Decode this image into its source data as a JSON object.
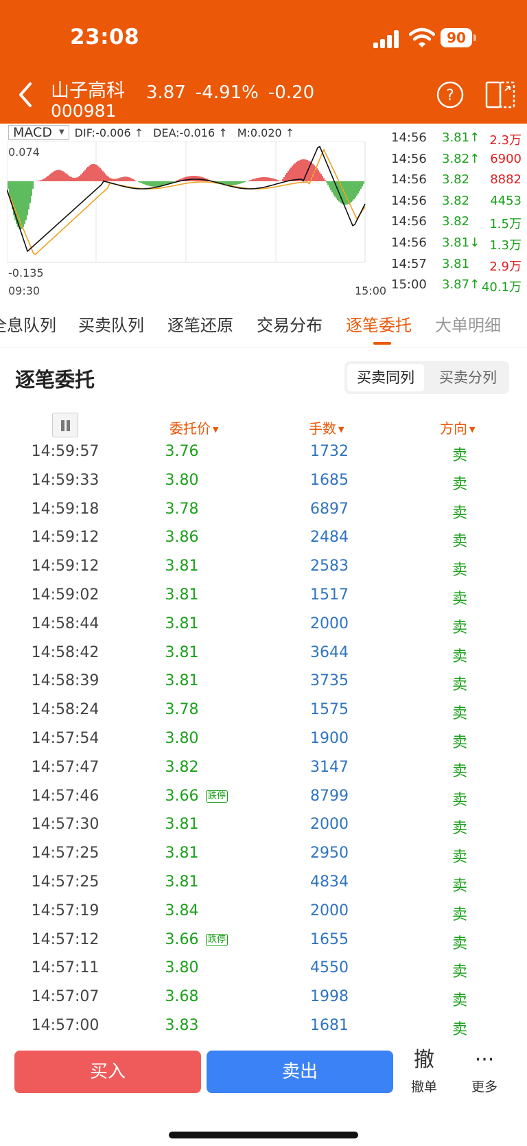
{
  "status": {
    "time": "23:08",
    "battery": "90"
  },
  "header": {
    "name": "山子高科",
    "code": "000981",
    "price": "3.87",
    "change_pct": "-4.91%",
    "change": "-0.20"
  },
  "chart": {
    "indicator": "MACD",
    "dif": "DIF:-0.006 ↑",
    "dea": "DEA:-0.016 ↑",
    "m": "M:0.020 ↑",
    "y_top": "0.074",
    "y_bottom": "-0.135",
    "x_start": "09:30",
    "x_end": "15:00"
  },
  "ticks": [
    {
      "time": "14:56",
      "price": "3.81↑",
      "vol": "2.3万",
      "pcolor": "#1aa01a",
      "vcolor": "#e02020"
    },
    {
      "time": "14:56",
      "price": "3.82↑",
      "vol": "6900",
      "pcolor": "#1aa01a",
      "vcolor": "#e02020"
    },
    {
      "time": "14:56",
      "price": "3.82",
      "vol": "8882",
      "pcolor": "#1aa01a",
      "vcolor": "#e02020"
    },
    {
      "time": "14:56",
      "price": "3.82",
      "vol": "4453",
      "pcolor": "#1aa01a",
      "vcolor": "#1aa01a"
    },
    {
      "time": "14:56",
      "price": "3.82",
      "vol": "1.5万",
      "pcolor": "#1aa01a",
      "vcolor": "#1aa01a"
    },
    {
      "time": "14:56",
      "price": "3.81↓",
      "vol": "1.3万",
      "pcolor": "#1aa01a",
      "vcolor": "#1aa01a"
    },
    {
      "time": "14:57",
      "price": "3.81",
      "vol": "2.9万",
      "pcolor": "#1aa01a",
      "vcolor": "#e02020"
    },
    {
      "time": "15:00",
      "price": "3.87↑",
      "vol": "40.1万",
      "pcolor": "#1aa01a",
      "vcolor": "#1aa01a"
    }
  ],
  "tabs": [
    {
      "label": "全息队列"
    },
    {
      "label": "买卖队列"
    },
    {
      "label": "逐笔还原"
    },
    {
      "label": "交易分布"
    },
    {
      "label": "逐笔委托"
    },
    {
      "label": "大单明细"
    }
  ],
  "section": {
    "title": "逐笔委托",
    "seg_on": "买卖同列",
    "seg_off": "买卖分列"
  },
  "columns": {
    "price": "委托价",
    "volume": "手数",
    "direction": "方向"
  },
  "rows": [
    {
      "time": "14:59:57",
      "price": "3.76",
      "vol": "1732",
      "dir": "卖",
      "tag": ""
    },
    {
      "time": "14:59:33",
      "price": "3.80",
      "vol": "1685",
      "dir": "卖",
      "tag": ""
    },
    {
      "time": "14:59:18",
      "price": "3.78",
      "vol": "6897",
      "dir": "卖",
      "tag": ""
    },
    {
      "time": "14:59:12",
      "price": "3.86",
      "vol": "2484",
      "dir": "卖",
      "tag": ""
    },
    {
      "time": "14:59:12",
      "price": "3.81",
      "vol": "2583",
      "dir": "卖",
      "tag": ""
    },
    {
      "time": "14:59:02",
      "price": "3.81",
      "vol": "1517",
      "dir": "卖",
      "tag": ""
    },
    {
      "time": "14:58:44",
      "price": "3.81",
      "vol": "2000",
      "dir": "卖",
      "tag": ""
    },
    {
      "time": "14:58:42",
      "price": "3.81",
      "vol": "3644",
      "dir": "卖",
      "tag": ""
    },
    {
      "time": "14:58:39",
      "price": "3.81",
      "vol": "3735",
      "dir": "卖",
      "tag": ""
    },
    {
      "time": "14:58:24",
      "price": "3.78",
      "vol": "1575",
      "dir": "卖",
      "tag": ""
    },
    {
      "time": "14:57:54",
      "price": "3.80",
      "vol": "1900",
      "dir": "卖",
      "tag": ""
    },
    {
      "time": "14:57:47",
      "price": "3.82",
      "vol": "3147",
      "dir": "卖",
      "tag": ""
    },
    {
      "time": "14:57:46",
      "price": "3.66",
      "vol": "8799",
      "dir": "卖",
      "tag": "跌停"
    },
    {
      "time": "14:57:30",
      "price": "3.81",
      "vol": "2000",
      "dir": "卖",
      "tag": ""
    },
    {
      "time": "14:57:25",
      "price": "3.81",
      "vol": "2950",
      "dir": "卖",
      "tag": ""
    },
    {
      "time": "14:57:25",
      "price": "3.81",
      "vol": "4834",
      "dir": "卖",
      "tag": ""
    },
    {
      "time": "14:57:19",
      "price": "3.84",
      "vol": "2000",
      "dir": "卖",
      "tag": ""
    },
    {
      "time": "14:57:12",
      "price": "3.66",
      "vol": "1655",
      "dir": "卖",
      "tag": "跌停"
    },
    {
      "time": "14:57:11",
      "price": "3.80",
      "vol": "4550",
      "dir": "卖",
      "tag": ""
    },
    {
      "time": "14:57:07",
      "price": "3.68",
      "vol": "1998",
      "dir": "卖",
      "tag": ""
    },
    {
      "time": "14:57:00",
      "price": "3.83",
      "vol": "1681",
      "dir": "卖",
      "tag": ""
    }
  ],
  "bottom": {
    "buy": "买入",
    "sell": "卖出",
    "cancel_icon": "撤",
    "cancel": "撤单",
    "more": "更多"
  },
  "colors": {
    "brand": "#ea5808",
    "up": "#e02020",
    "down": "#1aa01a",
    "volume": "#2f74c0"
  }
}
